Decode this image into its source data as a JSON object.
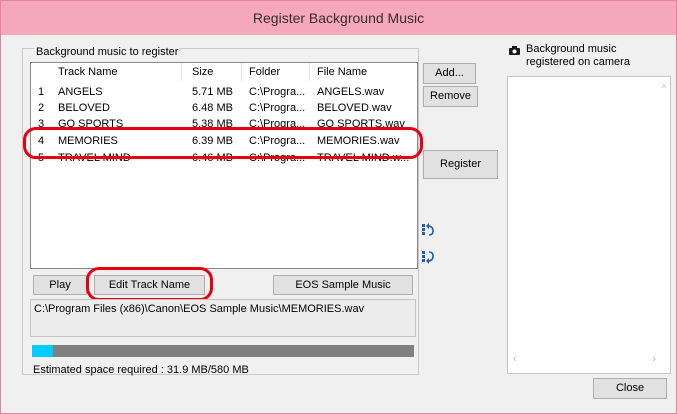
{
  "window": {
    "title": "Register Background Music"
  },
  "left_panel": {
    "group_label": "Background music to register"
  },
  "track_table": {
    "columns": [
      "Track Name",
      "Size",
      "Folder",
      "File Name"
    ],
    "rows": [
      {
        "num": "1",
        "name": "ANGELS",
        "size": "5.71 MB",
        "folder": "C:\\Progra...",
        "file": "ANGELS.wav"
      },
      {
        "num": "2",
        "name": "BELOVED",
        "size": "6.48 MB",
        "folder": "C:\\Progra...",
        "file": "BELOVED.wav"
      },
      {
        "num": "3",
        "name": "GO SPORTS",
        "size": "5.38 MB",
        "folder": "C:\\Progra...",
        "file": "GO SPORTS.wav"
      },
      {
        "num": "4",
        "name": "MEMORIES",
        "size": "6.39 MB",
        "folder": "C:\\Progra...",
        "file": "MEMORIES.wav"
      },
      {
        "num": "5",
        "name": "TRAVEL MIND",
        "size": "6.46 MB",
        "folder": "C:\\Progra...",
        "file": "TRAVEL MIND.w..."
      }
    ]
  },
  "buttons": {
    "add": "Add...",
    "remove": "Remove",
    "register": "Register",
    "play": "Play",
    "edit_track_name": "Edit Track Name",
    "eos_sample_music": "EOS Sample Music",
    "close": "Close"
  },
  "file_path": "C:\\Program Files (x86)\\Canon\\EOS Sample Music\\MEMORIES.wav",
  "space": {
    "estimated_text": "Estimated space required : 31.9 MB/580 MB",
    "used_fraction": 0.055
  },
  "right_panel": {
    "label_line1": "Background music",
    "label_line2": "registered on camera",
    "icon": "camera-icon"
  },
  "colors": {
    "title_bar": "#f4a8b9",
    "highlight": "#e60012",
    "progress_fill": "#00ccff"
  }
}
